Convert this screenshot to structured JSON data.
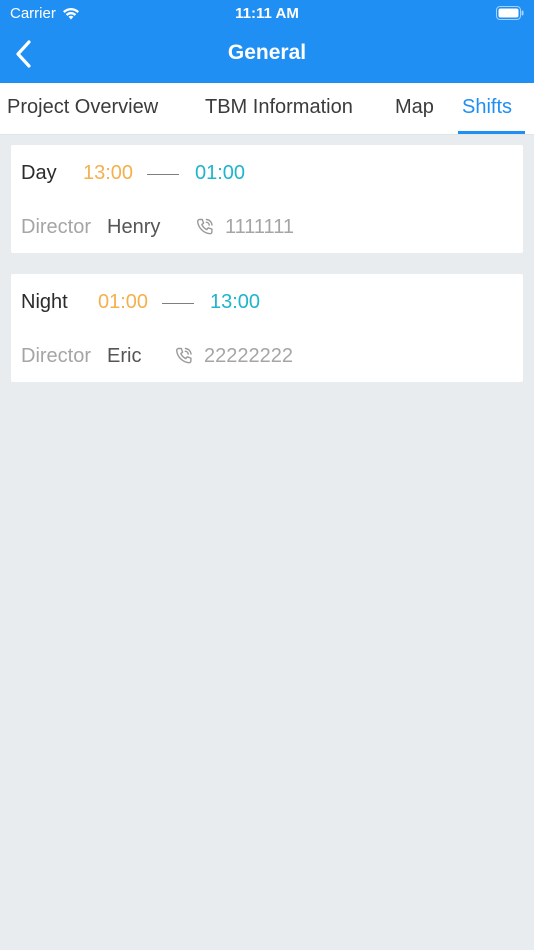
{
  "status_bar": {
    "carrier": "Carrier",
    "time": "11:11 AM"
  },
  "nav": {
    "title": "General",
    "back_icon": "chevron-left-icon"
  },
  "tabs": [
    {
      "label": "Project Overview",
      "active": false
    },
    {
      "label": "TBM Information",
      "active": false
    },
    {
      "label": "Map",
      "active": false
    },
    {
      "label": "Shifts",
      "active": true
    }
  ],
  "shifts": [
    {
      "name": "Day",
      "start": "13:00",
      "end": "01:00",
      "director_label": "Director",
      "director": "Henry",
      "phone": "1111111"
    },
    {
      "name": "Night",
      "start": "01:00",
      "end": "13:00",
      "director_label": "Director",
      "director": "Eric",
      "phone": "22222222"
    }
  ],
  "colors": {
    "brand": "#1f8ff3",
    "start_time": "#f5b04d",
    "end_time": "#1fb5cc",
    "background": "#e9ecef"
  }
}
